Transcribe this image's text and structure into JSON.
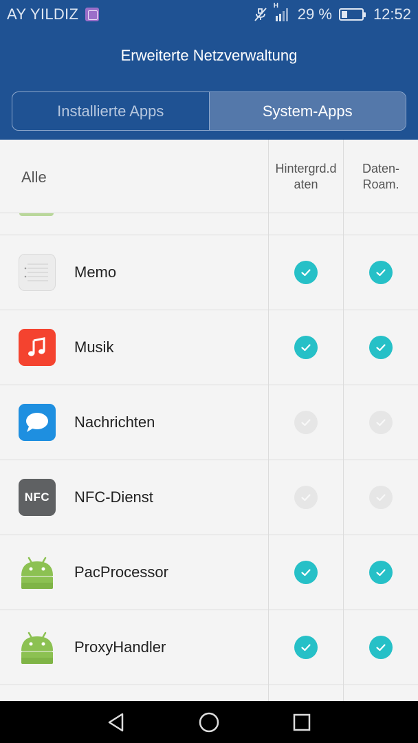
{
  "status_bar": {
    "carrier": "AY YILDIZ",
    "network_type": "H",
    "battery_percent": "29 %",
    "battery_level": 0.29,
    "time": "12:52",
    "icons": [
      "gallery-notification-icon",
      "mute-icon",
      "signal-icon",
      "battery-icon"
    ]
  },
  "header": {
    "title": "Erweiterte Netzverwaltung",
    "tabs": [
      {
        "label": "Installierte Apps",
        "selected": false
      },
      {
        "label": "System-Apps",
        "selected": true
      }
    ]
  },
  "list": {
    "filter_label": "Alle",
    "columns": [
      "Hintergrd.d\naten",
      "Daten-\nRoam."
    ],
    "rows": [
      {
        "name": "Memo",
        "icon": "memo-app-icon",
        "background_data": true,
        "data_roaming": true
      },
      {
        "name": "Musik",
        "icon": "music-app-icon",
        "background_data": true,
        "data_roaming": true
      },
      {
        "name": "Nachrichten",
        "icon": "messages-app-icon",
        "background_data": false,
        "data_roaming": false
      },
      {
        "name": "NFC-Dienst",
        "icon": "nfc-app-icon",
        "icon_text": "NFC",
        "background_data": false,
        "data_roaming": false
      },
      {
        "name": "PacProcessor",
        "icon": "android-app-icon",
        "background_data": true,
        "data_roaming": true
      },
      {
        "name": "ProxyHandler",
        "icon": "android-app-icon",
        "background_data": true,
        "data_roaming": true
      }
    ]
  },
  "colors": {
    "header": "#1f5293",
    "check_on": "#26c0c7",
    "check_off": "#e6e6e6",
    "music": "#f4432f",
    "messages": "#1e8fe0",
    "android": "#8cc152"
  },
  "nav": [
    "back-icon",
    "home-icon",
    "recents-icon"
  ]
}
